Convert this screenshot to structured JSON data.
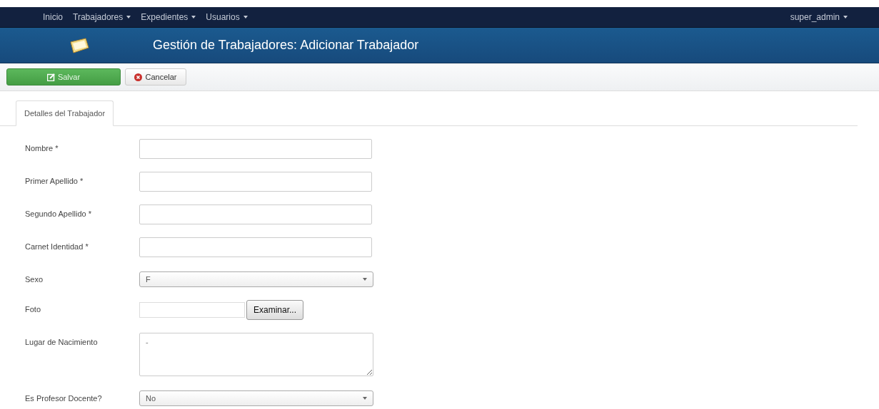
{
  "navbar": {
    "items": [
      {
        "label": "Inicio",
        "dropdown": false
      },
      {
        "label": "Trabajadores",
        "dropdown": true
      },
      {
        "label": "Expedientes",
        "dropdown": true
      },
      {
        "label": "Usuarios",
        "dropdown": true
      }
    ],
    "user": {
      "label": "super_admin",
      "dropdown": true
    }
  },
  "header": {
    "title": "Gestión de Trabajadores: Adicionar Trabajador"
  },
  "toolbar": {
    "buttons": [
      {
        "label": "Salvar",
        "kind": "save"
      },
      {
        "label": "Cancelar",
        "kind": "cancel"
      }
    ]
  },
  "tabs": [
    {
      "label": "Detalles del Trabajador",
      "selected": true
    }
  ],
  "form": {
    "fields": [
      {
        "label": "Nombre *",
        "kind": "text"
      },
      {
        "label": "Primer Apellido *",
        "kind": "text"
      },
      {
        "label": "Segundo Apellido *",
        "kind": "text"
      },
      {
        "label": "Carnet Identidad *",
        "kind": "text"
      },
      {
        "label": "Sexo",
        "kind": "select",
        "value": "F"
      },
      {
        "label": "Foto",
        "kind": "file",
        "button": "Examinar..."
      },
      {
        "label": "Lugar de Nacimiento",
        "kind": "textarea",
        "value": "-"
      },
      {
        "label": "Es Profesor Docente?",
        "kind": "select",
        "value": "No"
      }
    ]
  }
}
